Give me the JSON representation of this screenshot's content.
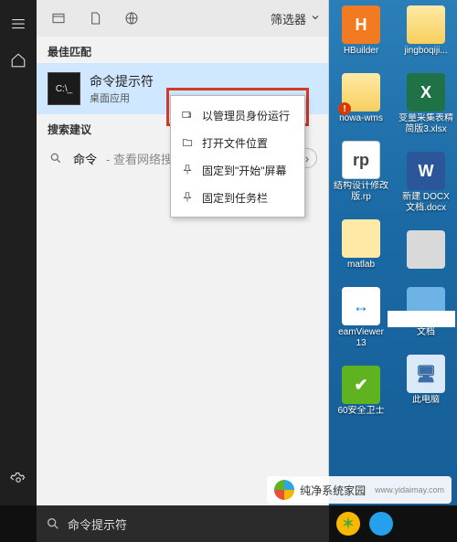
{
  "filter_label": "筛选器",
  "sections": {
    "best": "最佳匹配",
    "suggest": "搜索建议"
  },
  "best_match": {
    "title": "命令提示符",
    "subtitle": "桌面应用",
    "icon": "cmd-icon"
  },
  "suggestion": {
    "term": "命令",
    "hint": " - 查看网络搜索"
  },
  "context_menu": {
    "items": [
      {
        "label": "以管理员身份运行",
        "icon": "admin-run-icon"
      },
      {
        "label": "打开文件位置",
        "icon": "open-location-icon"
      },
      {
        "label": "固定到\"开始\"屏幕",
        "icon": "pin-start-icon"
      },
      {
        "label": "固定到任务栏",
        "icon": "pin-taskbar-icon"
      }
    ]
  },
  "searchbox": {
    "value": "命令提示符"
  },
  "desktop_icons": {
    "col_a": [
      {
        "label": "HBuilder",
        "tile": "orange",
        "glyph": "H"
      },
      {
        "label": "nowa-wms",
        "tile": "folder badge",
        "glyph": ""
      },
      {
        "label": "结构设计修改版.rp",
        "tile": "rp",
        "glyph": "rp"
      },
      {
        "label": "matlab",
        "tile": "matlab",
        "glyph": ""
      },
      {
        "label": "eamViewer 13",
        "tile": "tv",
        "glyph": "↔"
      },
      {
        "label": "60安全卫士",
        "tile": "safe",
        "glyph": "✔"
      }
    ],
    "col_b": [
      {
        "label": "jingboqiji...",
        "tile": "folder",
        "glyph": ""
      },
      {
        "label": "变量采集表精简版3.xlsx",
        "tile": "excel",
        "glyph": "X"
      },
      {
        "label": "新建 DOCX 文档.docx",
        "tile": "word",
        "glyph": "W"
      },
      {
        "label": "",
        "tile": "img",
        "glyph": ""
      },
      {
        "label": "文档",
        "tile": "doc",
        "glyph": ""
      },
      {
        "label": "此电脑",
        "tile": "pc",
        "glyph": "🖥"
      }
    ]
  },
  "watermark": {
    "title": "纯净系统家园",
    "url": "www.yidaimay.com"
  }
}
